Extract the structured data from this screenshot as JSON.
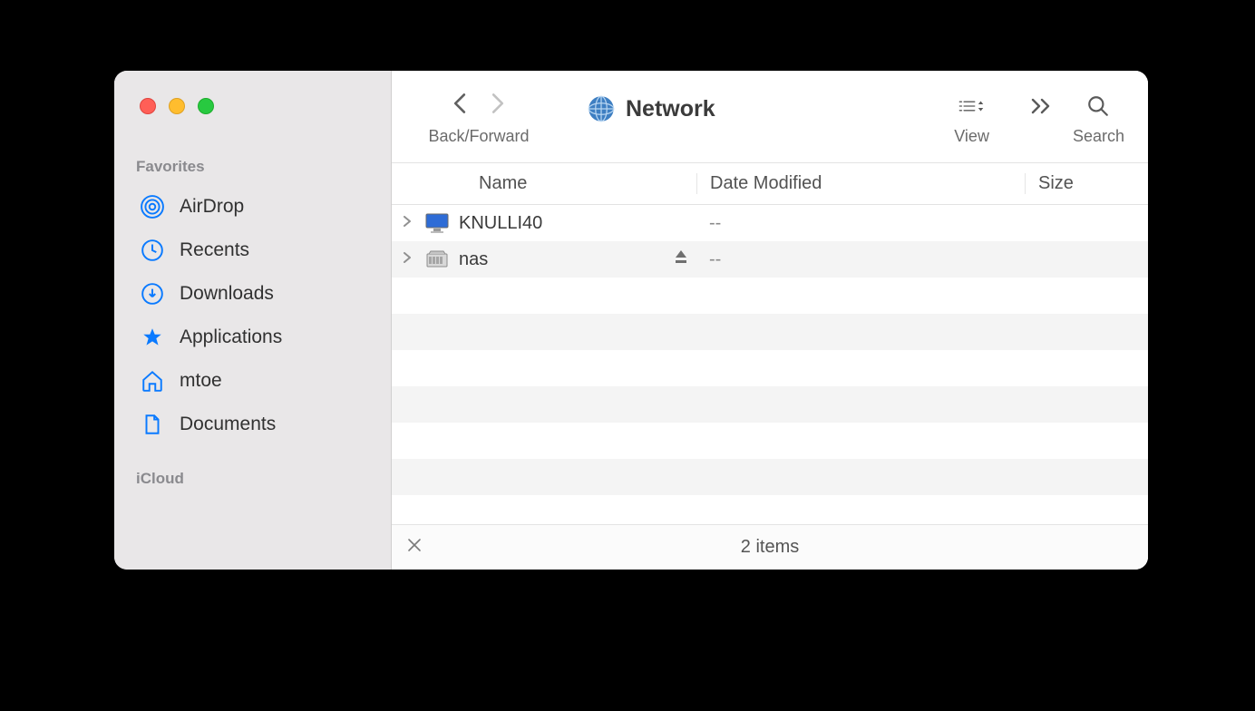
{
  "sidebar": {
    "sections": [
      {
        "label": "Favorites",
        "items": [
          {
            "icon": "airdrop",
            "label": "AirDrop"
          },
          {
            "icon": "recents",
            "label": "Recents"
          },
          {
            "icon": "downloads",
            "label": "Downloads"
          },
          {
            "icon": "applications",
            "label": "Applications"
          },
          {
            "icon": "home",
            "label": "mtoe"
          },
          {
            "icon": "document",
            "label": "Documents"
          }
        ]
      },
      {
        "label": "iCloud",
        "items": []
      }
    ]
  },
  "toolbar": {
    "back_forward_label": "Back/Forward",
    "title": "Network",
    "view_label": "View",
    "search_label": "Search"
  },
  "columns": {
    "name": "Name",
    "date": "Date Modified",
    "size": "Size"
  },
  "items": [
    {
      "name": "KNULLI40",
      "icon": "display",
      "eject": false,
      "date": "--",
      "size": ""
    },
    {
      "name": "nas",
      "icon": "server",
      "eject": true,
      "date": "--",
      "size": ""
    }
  ],
  "status": {
    "text": "2 items"
  }
}
